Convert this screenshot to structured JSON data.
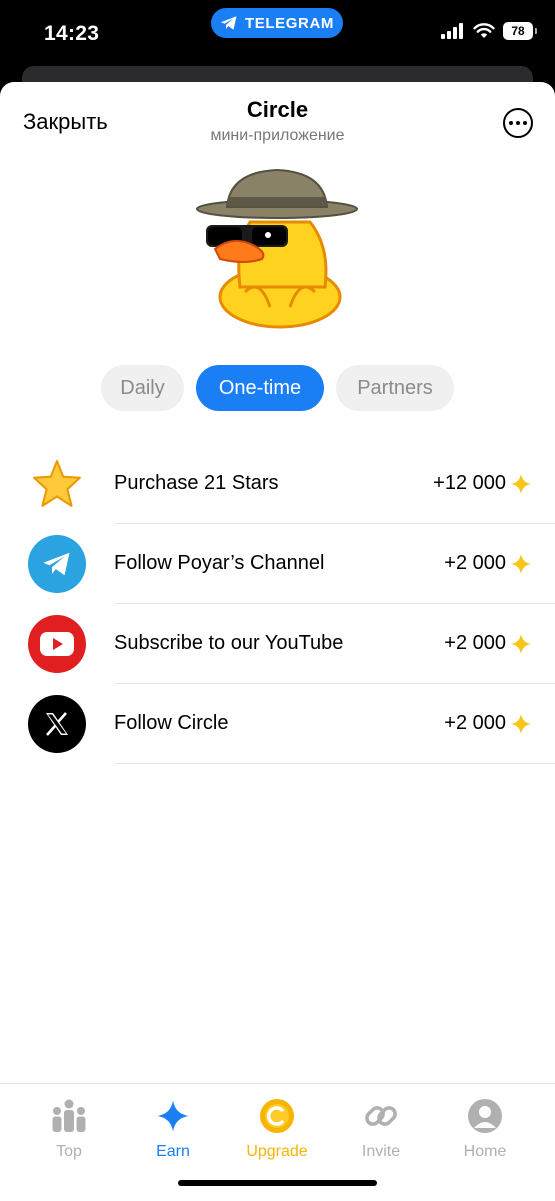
{
  "status_bar": {
    "time": "14:23",
    "app_pill": "TELEGRAM",
    "battery": "78"
  },
  "header": {
    "close_label": "Закрыть",
    "title": "Circle",
    "subtitle": "мини-приложение"
  },
  "tabs": [
    {
      "label": "Daily",
      "active": false
    },
    {
      "label": "One-time",
      "active": true
    },
    {
      "label": "Partners",
      "active": false
    }
  ],
  "tasks": [
    {
      "icon": "star-icon",
      "title": "Purchase 21 Stars",
      "reward": "+12 000"
    },
    {
      "icon": "telegram-icon",
      "title": "Follow Poyar’s Channel",
      "reward": "+2 000"
    },
    {
      "icon": "youtube-icon",
      "title": "Subscribe to our YouTube",
      "reward": "+2 000"
    },
    {
      "icon": "x-icon",
      "title": "Follow Circle",
      "reward": "+2 000"
    }
  ],
  "bottom_nav": [
    {
      "label": "Top",
      "icon": "people-icon",
      "color": "#b0b0b0"
    },
    {
      "label": "Earn",
      "icon": "sparkle-icon",
      "color": "#1a7ff5",
      "active": true
    },
    {
      "label": "Upgrade",
      "icon": "coin-icon",
      "color": "#f5b400"
    },
    {
      "label": "Invite",
      "icon": "link-icon",
      "color": "#b0b0b0"
    },
    {
      "label": "Home",
      "icon": "profile-icon",
      "color": "#b0b0b0"
    }
  ],
  "colors": {
    "accent": "#1a7ff5",
    "reward_sparkle": "#f5c518",
    "upgrade": "#f5b400",
    "inactive": "#b0b0b0"
  }
}
